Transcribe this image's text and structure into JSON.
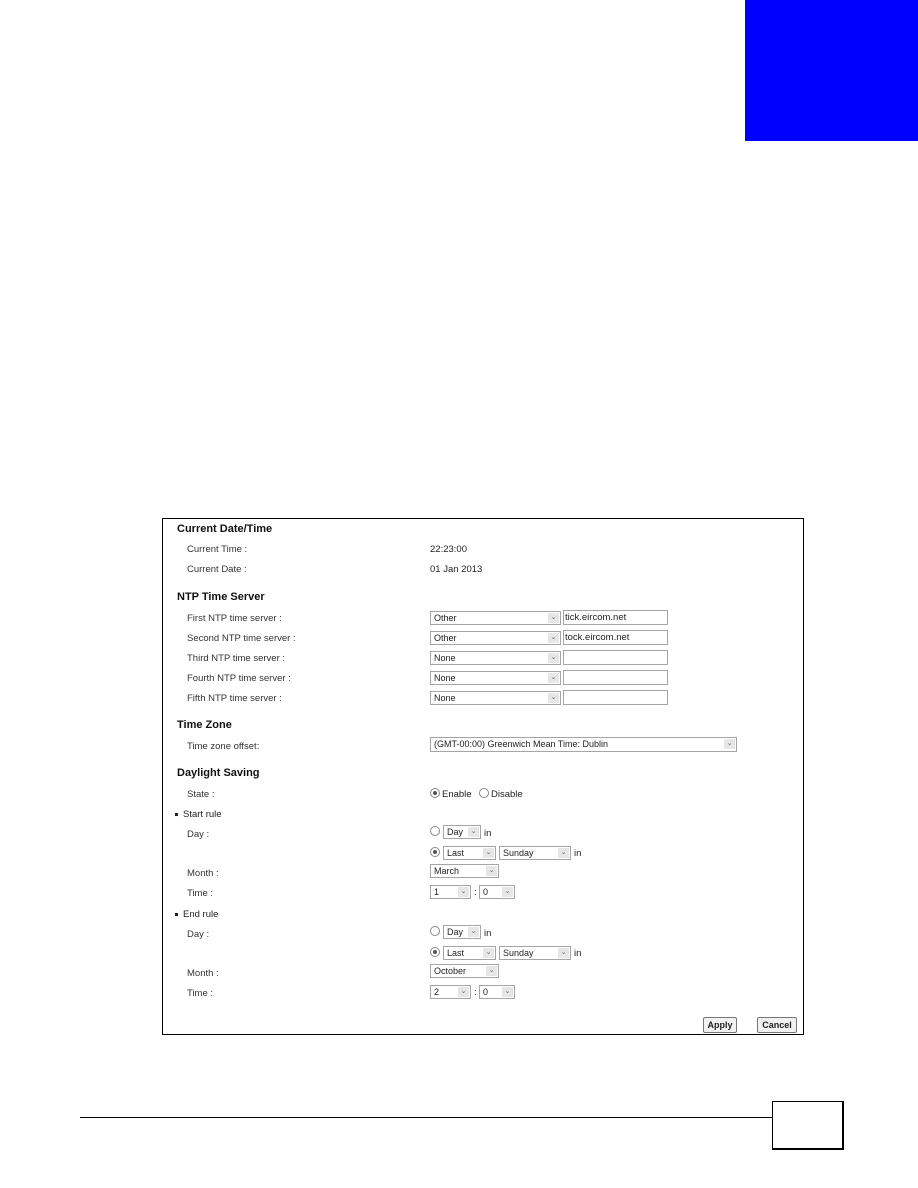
{
  "chapter_tab_color": "#0000fe",
  "sections": {
    "current": {
      "title": "Current Date/Time",
      "time_label": "Current Time :",
      "time_value": "22:23:00",
      "date_label": "Current Date :",
      "date_value": "01 Jan 2013"
    },
    "ntp": {
      "title": "NTP Time Server",
      "servers": [
        {
          "label": "First NTP time server :",
          "select": "Other",
          "input": "tick.eircom.net"
        },
        {
          "label": "Second NTP time server :",
          "select": "Other",
          "input": "tock.eircom.net"
        },
        {
          "label": "Third NTP time server :",
          "select": "None",
          "input": ""
        },
        {
          "label": "Fourth NTP time server :",
          "select": "None",
          "input": ""
        },
        {
          "label": "Fifth NTP time server :",
          "select": "None",
          "input": ""
        }
      ]
    },
    "timezone": {
      "title": "Time Zone",
      "offset_label": "Time zone offset:",
      "offset_value": "(GMT-00:00) Greenwich Mean Time: Dublin"
    },
    "daylight": {
      "title": "Daylight Saving",
      "state_label": "State :",
      "enable_label": "Enable",
      "disable_label": "Disable",
      "state": "Enable",
      "start_rule": {
        "title": "Start rule",
        "day_label": "Day :",
        "day_select": "Day",
        "in_text": "in",
        "week_select": "Last",
        "weekday_select": "Sunday",
        "selected_option": "week",
        "month_label": "Month :",
        "month_select": "March",
        "time_label": "Time :",
        "hour_select": "1",
        "minute_select": "0",
        "time_sep": ":"
      },
      "end_rule": {
        "title": "End rule",
        "day_label": "Day :",
        "day_select": "Day",
        "in_text": "in",
        "week_select": "Last",
        "weekday_select": "Sunday",
        "selected_option": "week",
        "month_label": "Month :",
        "month_select": "October",
        "time_label": "Time :",
        "hour_select": "2",
        "minute_select": "0",
        "time_sep": ":"
      }
    }
  },
  "buttons": {
    "apply": "Apply",
    "cancel": "Cancel"
  },
  "select_arrow": "⌄"
}
